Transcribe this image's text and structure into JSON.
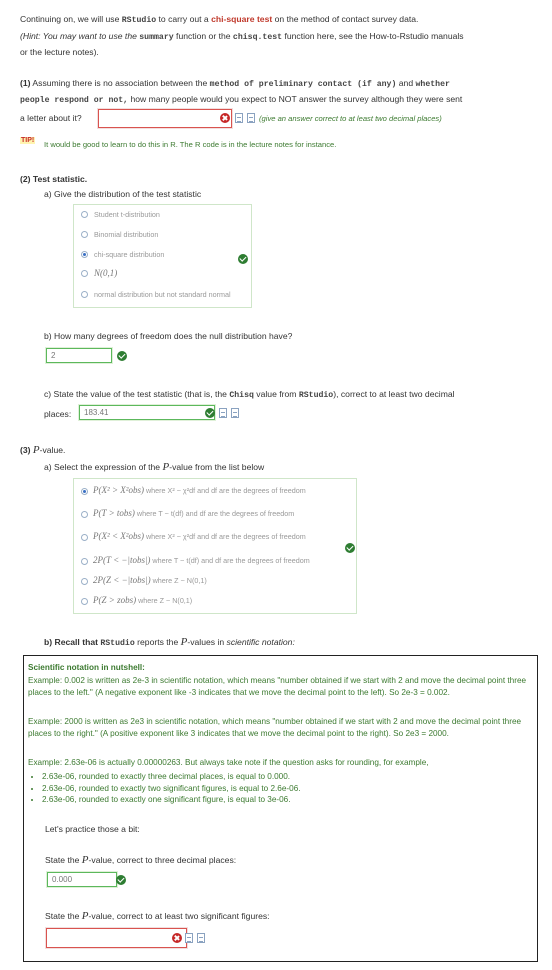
{
  "intro": {
    "line1_pre": "Continuing on, we will use ",
    "line1_code": "RStudio",
    "line1_mid": " to carry out a ",
    "line1_red": "chi-square test",
    "line1_post": " on the method of contact survey data.",
    "hint_a": "(Hint: You may want to use the ",
    "hint_code1": "summary",
    "hint_b": " function or the ",
    "hint_code2": "chisq.test",
    "hint_c": " function here, see the How-to-Rstudio manuals",
    "hint_d": "or the lecture notes)."
  },
  "q1": {
    "num": "(1)",
    "t1": " Assuming there is no association between the ",
    "c1": "method of preliminary contact (if any)",
    "t2": " and ",
    "c2": "whether",
    "c3": "people respond or not,",
    "t3": " how many people would you expect to NOT answer the survey although they were sent",
    "t4": "a letter about it?",
    "answer": "",
    "note": "(give an answer correct to at least two decimal places)",
    "tip_badge": "TIP!",
    "tip_text": "It would be good to learn to do this in R. The R code is in the lecture notes for instance."
  },
  "q2": {
    "heading": "(2) Test statistic.",
    "a_label": "a) Give the distribution of the test statistic",
    "options": [
      "Student t-distribution",
      "Binomial distribution",
      "chi-square distribution",
      "N(0,1)",
      "normal distribution but not standard normal"
    ],
    "selected_index": 2,
    "b_label": "b) How many degrees of freedom does the null distribution have?",
    "b_answer": "2",
    "c_label_a": "c) State the value of the test statistic (that is, the ",
    "c_code1": "Chisq",
    "c_label_b": " value from ",
    "c_code2": "RStudio",
    "c_label_c": "), correct to at least two decimal",
    "c_label_d": "places:",
    "c_answer": "183.41"
  },
  "q3": {
    "heading_a": "(3) ",
    "heading_b": "P",
    "heading_c": "-value.",
    "a_label_a": "a) Select the expression of the ",
    "a_label_b": "P",
    "a_label_c": "-value from the list below",
    "pv_options": [
      {
        "expr": "P(X² > X²obs)",
        "rest": " where X² ~ χ²df and df are the degrees of freedom"
      },
      {
        "expr": "P(T > tobs)",
        "rest": " where T ~ t(df) and df are the degrees of freedom"
      },
      {
        "expr": "P(X² < X²obs)",
        "rest": " where X² ~ χ²df and df are the degrees of freedom"
      },
      {
        "expr": "2P(T < −|tobs|)",
        "rest": " where T ~ t(df) and df are the degrees of freedom"
      },
      {
        "expr": "2P(Z < −|tobs|)",
        "rest": " where Z ~ N(0,1)"
      },
      {
        "expr": "P(Z > zobs)",
        "rest": " where Z ~ N(0,1)"
      }
    ],
    "pv_selected_index": 0,
    "b_label_a": "b) Recall that ",
    "b_code": "RStudio",
    "b_label_b": " reports the ",
    "b_label_c": "P",
    "b_label_d": "-values in ",
    "b_label_e": "scientific notation:",
    "sci_title": "Scientific notation in nutshell:",
    "sci_p1": "Example: 0.002 is written as 2e-3 in scientific notation, which means \"number obtained if we start with 2 and move the decimal point three places to the left.\" (A negative exponent like -3 indicates that we move the decimal point to the left). So 2e-3 = 0.002.",
    "sci_p2": "Example: 2000 is written as 2e3 in scientific notation, which means \"number obtained if we start with 2 and move the decimal point three places to the right.\" (A positive exponent like 3 indicates that we move the decimal point to the right). So 2e3 = 2000.",
    "sci_p3": "Example: 2.63e-06 is actually 0.00000263. But always take note if the question asks for rounding, for example,",
    "sci_items": [
      "2.63e-06, rounded to exactly three decimal places, is equal to 0.000.",
      "2.63e-06, rounded to exactly two significant figures, is equal to 2.6e-06.",
      "2.63e-06, rounded to exactly one significant figure, is equal to 3e-06."
    ],
    "practice": "Let's practice those a bit:",
    "p3_label_a": "State the ",
    "p3_label_b": "P",
    "p3_label_c": "-value, correct to three decimal places:",
    "p3_answer": "0.000",
    "sig_label_a": "State the ",
    "sig_label_b": "P",
    "sig_label_c": "-value, correct to at least two significant figures:",
    "sig_answer": ""
  },
  "colors": {
    "correct": "#2e7d32",
    "wrong": "#c62828",
    "accent_red": "#c0392b",
    "sci_green": "#3c7a30"
  }
}
